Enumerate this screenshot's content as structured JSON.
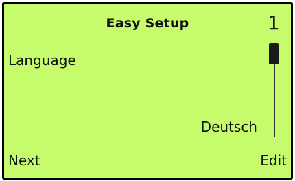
{
  "screen": {
    "title": "Easy Setup",
    "page_number": "1",
    "parameter_label": "Language",
    "parameter_value": "Deutsch",
    "scroll_position": 0
  },
  "softkeys": {
    "left_label": "Next",
    "right_label": "Edit"
  },
  "colors": {
    "background": "#c6fc6c",
    "text": "#111111",
    "border": "#000000"
  }
}
